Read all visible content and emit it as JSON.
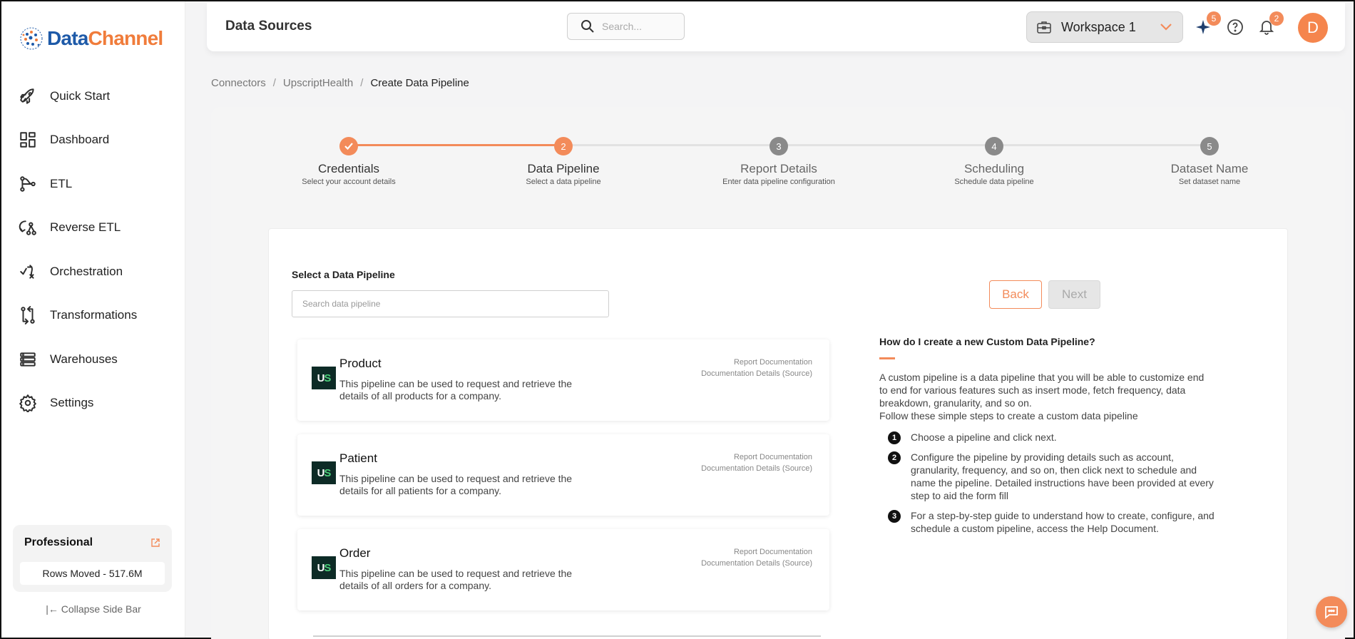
{
  "brand": {
    "part1": "Data",
    "part2": "Channel"
  },
  "sidebar": {
    "items": [
      {
        "label": "Quick Start",
        "icon": "rocket-icon"
      },
      {
        "label": "Dashboard",
        "icon": "dashboard-icon"
      },
      {
        "label": "ETL",
        "icon": "etl-icon"
      },
      {
        "label": "Reverse ETL",
        "icon": "reverse-etl-icon"
      },
      {
        "label": "Orchestration",
        "icon": "orchestration-icon"
      },
      {
        "label": "Transformations",
        "icon": "transformations-icon"
      },
      {
        "label": "Warehouses",
        "icon": "warehouses-icon"
      },
      {
        "label": "Settings",
        "icon": "gear-icon"
      }
    ],
    "plan": {
      "title": "Professional",
      "rows_moved": "Rows Moved - 517.6M"
    },
    "collapse_label": "Collapse Side Bar"
  },
  "header": {
    "title": "Data Sources",
    "search_placeholder": "Search...",
    "workspace": "Workspace 1",
    "sparkle_badge": "5",
    "notification_badge": "2",
    "avatar_initial": "D"
  },
  "breadcrumb": {
    "items": [
      "Connectors",
      "UpscriptHealth"
    ],
    "current": "Create Data Pipeline"
  },
  "stepper": {
    "steps": [
      {
        "num": "1",
        "title": "Credentials",
        "subtitle": "Select your account details"
      },
      {
        "num": "2",
        "title": "Data Pipeline",
        "subtitle": "Select a data pipeline"
      },
      {
        "num": "3",
        "title": "Report Details",
        "subtitle": "Enter data pipeline configuration"
      },
      {
        "num": "4",
        "title": "Scheduling",
        "subtitle": "Schedule data pipeline"
      },
      {
        "num": "5",
        "title": "Dataset Name",
        "subtitle": "Set dataset name"
      }
    ],
    "current_step": 2
  },
  "selector": {
    "title": "Select a Data Pipeline",
    "placeholder": "Search data pipeline",
    "back_label": "Back",
    "next_label": "Next"
  },
  "pipelines": [
    {
      "logo": "US",
      "name": "Product",
      "description": "This pipeline can be used to request and retrieve the details of all products for a company.",
      "link1": "Report Documentation",
      "link2": "Documentation Details (Source)"
    },
    {
      "logo": "US",
      "name": "Patient",
      "description": "This pipeline can be used to request and retrieve the details for all patients for a company.",
      "link1": "Report Documentation",
      "link2": "Documentation Details (Source)"
    },
    {
      "logo": "US",
      "name": "Order",
      "description": "This pipeline can be used to request and retrieve the details of all orders for a company.",
      "link1": "Report Documentation",
      "link2": "Documentation Details (Source)"
    }
  ],
  "help": {
    "title": "How do I create a new Custom Data Pipeline?",
    "intro": "A custom pipeline is a data pipeline that you will be able to customize end to end for various features such as insert mode, fetch frequency, data breakdown, granularity, and so on.",
    "intro2": "Follow these simple steps to create a custom data pipeline",
    "steps": [
      {
        "num": "1",
        "text": "Choose a pipeline and click next."
      },
      {
        "num": "2",
        "text": "Configure the pipeline by providing details such as account, granularity, frequency, and so on, then click next to schedule and name the pipeline. Detailed instructions have been provided at every step to aid the form fill"
      },
      {
        "num": "3",
        "text": "For a step-by-step guide to understand how to create, configure, and schedule a custom pipeline, access the Help Document."
      }
    ]
  },
  "colors": {
    "accent": "#f38b5a",
    "brand_blue": "#1e5aa8",
    "brand_orange": "#f07c3b"
  }
}
